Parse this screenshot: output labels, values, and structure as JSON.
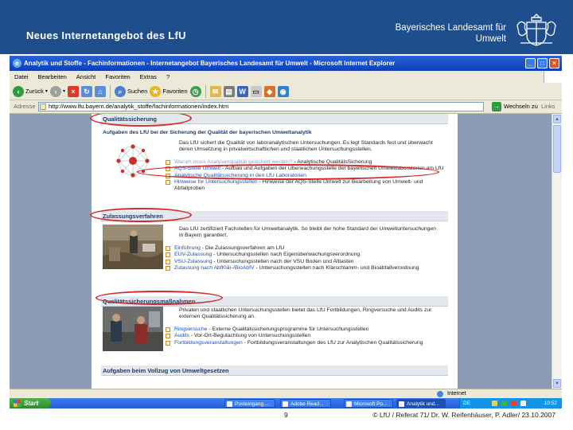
{
  "slide": {
    "title": "Neues Internetangebot des LfU",
    "org_line1": "Bayerisches Landesamt für",
    "org_line2": "Umwelt",
    "page_number": "9",
    "credit": "© LfU / Referat 71/ Dr. W. Reifenhäuser, P. Adler/ 23.10.2007"
  },
  "window": {
    "title": "Analytik und Stoffe - Fachinformationen - Internetangebot Bayerisches Landesamt für Umwelt - Microsoft Internet Explorer",
    "menu": [
      "Datei",
      "Bearbeiten",
      "Ansicht",
      "Favoriten",
      "Extras",
      "?"
    ],
    "toolbar": {
      "back": "Zurück",
      "search": "Suchen",
      "favorites": "Favoriten"
    },
    "address": {
      "label": "Adresse",
      "url": "http://www.lfu.bayern.de/analytik_stoffe/fachinformationen/index.htm",
      "go": "Wechseln zu",
      "links": "Links"
    },
    "status": {
      "zone": "Internet"
    }
  },
  "content": {
    "s1": {
      "title": "Qualitätssicherung",
      "subtitle": "Aufgaben des LfU bei der Sicherung der Qualität der bayerischen Umweltanalytik",
      "para": "Das LfU sichert die Qualität von laboranalytischen Untersuchungen. Es legt Standards fest und überwacht deren Umsetzung in privatwirtschaftlichen und staatlichen Untersuchungsstellen.",
      "links": [
        {
          "link": "Warum muss Analysenqualität gesichert werden?",
          "text": " - Analytische QualitätsSicherung"
        },
        {
          "link": "AQS-Stelle Umwelt",
          "text": " - Aufbau und Aufgaben der Überwachungsstelle der bayerischen Umweltlaboratorien am LfU"
        },
        {
          "link": "Analytische Qualitätssicherung in den LfU Laboratorien",
          "text": ""
        },
        {
          "link": "Hinweise für Untersuchungsstellen",
          "text": " - Hinweise der AQS-Stelle Umwelt zur Bearbeitung von Umwelt- und Abfallproben"
        }
      ]
    },
    "s2": {
      "title": "Zulassungsverfahren",
      "para": "Das LfU zertifiziert Fachstellen für Umweltanalytik. So bleibt der hohe Standard der Umweltuntersuchungen in Bayern garantiert.",
      "links": [
        {
          "link": "Einführung",
          "text": " - Die Zulassungsverfahren am LfU"
        },
        {
          "link": "EUV-Zulassung",
          "text": " - Untersuchungsstellen nach Eigenüberwachungsverordnung"
        },
        {
          "link": "VSU-Zulassung",
          "text": " - Untersuchungsstellen nach der VSU Boden und Altlasten"
        },
        {
          "link": "Zulassung nach AbfKlär-/BioAbfV",
          "text": " - Untersuchungsstellen nach Klärschlamm- und Bioabfallverordnung"
        }
      ]
    },
    "s3": {
      "title": "Qualitätssicherungsmaßnahmen",
      "para": "Privaten und staatlichen Untersuchungsstellen bietet das LfU Fortbildungen, Ringversuche und Audits zur externen Qualitätssicherung an.",
      "links": [
        {
          "link": "Ringversuche",
          "text": " - Externe Qualitätssicherungsprogramme für Untersuchungsstellen"
        },
        {
          "link": "Audits",
          "text": " - Vor-Ort-Begutachtung von Untersuchungsstellen"
        },
        {
          "link": "Fortbildungsveranstaltungen",
          "text": " - Fortbildungsveranstaltungen des LfU zur Analytischen Qualitätssicherung"
        }
      ]
    },
    "s4": {
      "title": "Aufgaben beim Vollzug von Umweltgesetzen"
    }
  },
  "taskbar": {
    "start": "Start",
    "tasks": [
      "Posteingang....",
      "Adobe Read...",
      "Microsoft Po...",
      "Analytik und...",
      "DE"
    ],
    "clock": "10:52"
  },
  "colors": {
    "slide_header": "#1f4e8c",
    "link": "#1b4fb3",
    "highlight": "#d42a2a"
  }
}
